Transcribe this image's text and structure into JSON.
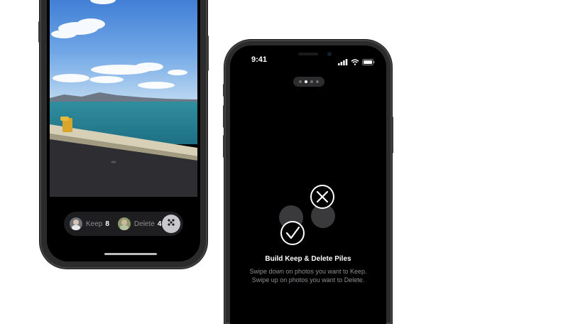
{
  "left_phone": {
    "keep_pile": {
      "label": "Keep",
      "count": "8"
    },
    "delete_pile": {
      "label": "Delete",
      "count": "4"
    },
    "more_button_icon": "dice-icon"
  },
  "right_phone": {
    "status": {
      "time": "9:41",
      "icons": [
        "signal-icon",
        "wifi-icon",
        "battery-icon"
      ]
    },
    "page_indicator": {
      "total": 4,
      "active_index": 1
    },
    "onboarding": {
      "title": "Build Keep & Delete Piles",
      "body_line1": "Swipe down on photos you want to Keep.",
      "body_line2": "Swipe up on photos you want to Delete."
    }
  },
  "colors": {
    "screen_bg": "#000000",
    "pill_bg": "#1e1e20",
    "label_gray": "#8e8e93",
    "circle_gray": "#3a3a3c"
  }
}
